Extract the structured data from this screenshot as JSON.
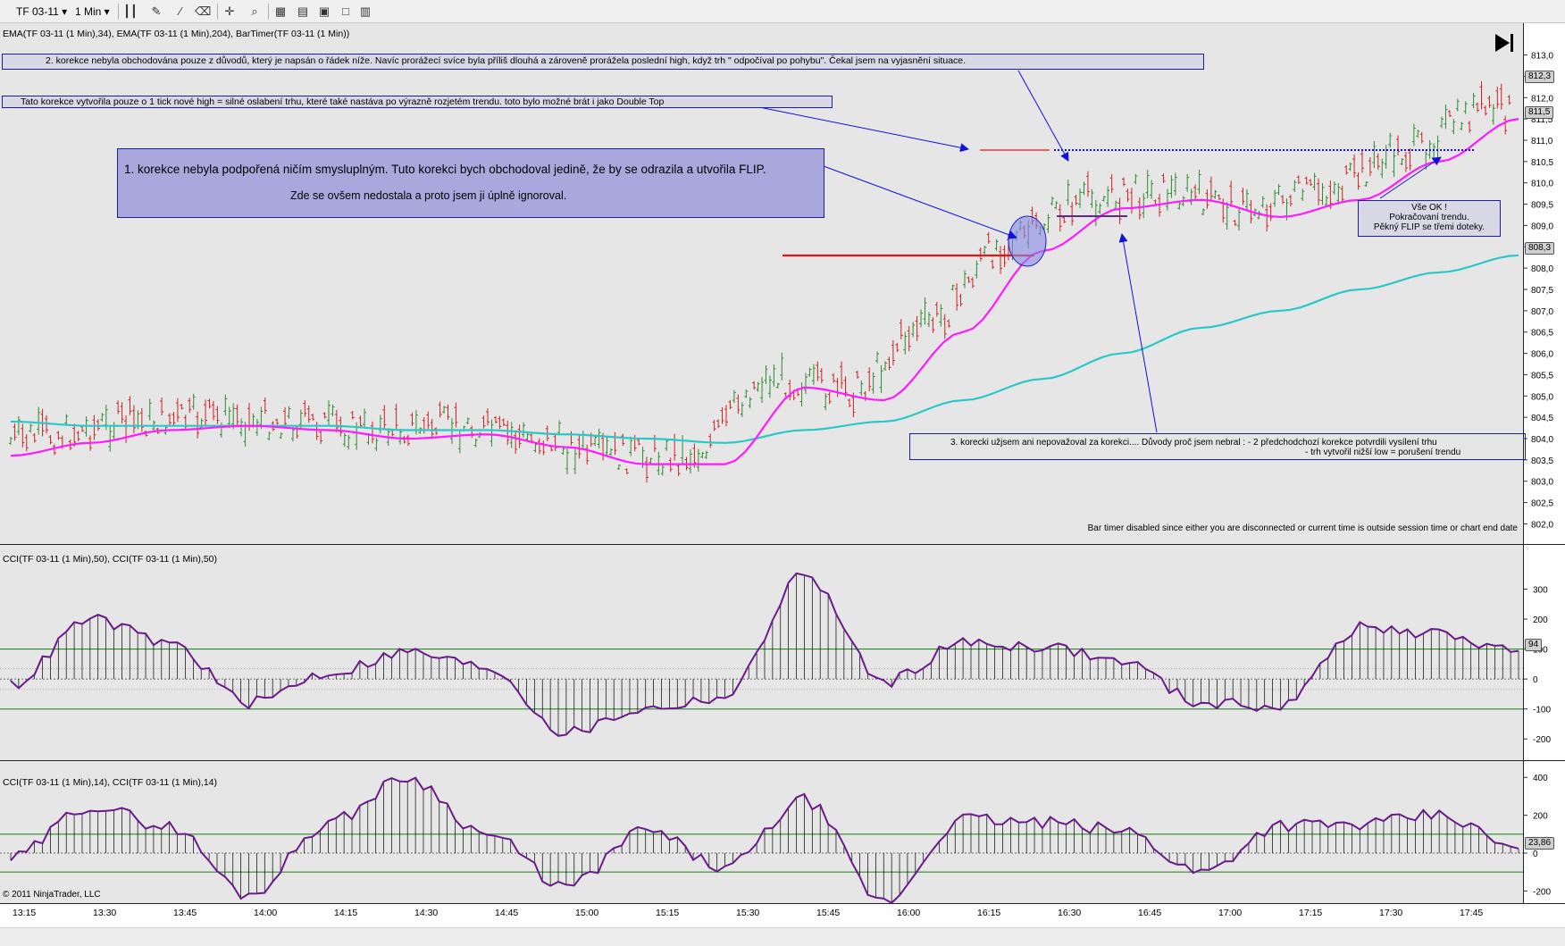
{
  "toolbar": {
    "instrument": "TF 03-11",
    "period": "1 Min"
  },
  "price_panel": {
    "indicator_label": "EMA(TF 03-11 (1 Min),34), EMA(TF 03-11 (1 Min),204), BarTimer(TF 03-11 (1 Min))",
    "y_ticks": [
      "813,0",
      "812,5",
      "812,0",
      "811,5",
      "811,0",
      "810,5",
      "810,0",
      "809,5",
      "809,0",
      "808,5",
      "808,0",
      "807,5",
      "807,0",
      "806,5",
      "806,0",
      "805,5",
      "805,0",
      "804,5",
      "804,0",
      "803,5",
      "803,0",
      "802,5",
      "802,0"
    ],
    "badges": {
      "last": "812,3",
      "ema34": "811,5",
      "ema204": "808,3"
    },
    "bar_timer_text": "Bar timer disabled since either you are disconnected or current time is outside session time or chart end date"
  },
  "annotations": {
    "a1": "2. korekce nebyla obchodována pouze z důvodů, který je napsán o řádek níže. Navíc prorážecí svíce byla příliš dlouhá a zároveně prorážela poslední high, když trh \" odpočíval po pohybu\". Čekal jsem na vyjasnění situace.",
    "a2": "Tato korekce vytvořila pouze o 1 tick nové high = silné oslabení trhu, které také nastáva po výrazně rozjetém trendu. toto bylo možné brát i jako Double Top",
    "a3_line1": "1. korekce nebyla podpořená ničím smysluplným. Tuto korekci bych obchodoval jedině, že by se odrazila a utvořila FLIP.",
    "a3_line2": "Zde se ovšem nedostala a proto jsem ji úplně ignoroval.",
    "a4_line1": "3. korecki užjsem ani nepovažoval za korekci.... Důvody proč jsem nebral : - 2 předchodchozí korekce potvrdili vysílení trhu",
    "a4_line2": "- trh vytvořil nižší low = porušení trendu",
    "a5_line1": "Vše OK !",
    "a5_line2": "Pokračovaní trendu.",
    "a5_line3": "Pěkný FLIP se třemi doteky."
  },
  "cci50_panel": {
    "label": "CCI(TF 03-11 (1 Min),50), CCI(TF 03-11 (1 Min),50)",
    "y_ticks": [
      "300",
      "200",
      "100",
      "0",
      "-100",
      "-200"
    ],
    "badge": "94"
  },
  "cci14_panel": {
    "label": "CCI(TF 03-11 (1 Min),14), CCI(TF 03-11 (1 Min),14)",
    "y_ticks": [
      "400",
      "200",
      "0",
      "-200"
    ],
    "badge": "23,86"
  },
  "time_axis": [
    "13:15",
    "13:30",
    "13:45",
    "14:00",
    "14:15",
    "14:30",
    "14:45",
    "15:00",
    "15:15",
    "15:30",
    "15:45",
    "16:00",
    "16:15",
    "16:30",
    "16:45",
    "17:00",
    "17:15",
    "17:30",
    "17:45"
  ],
  "copyright": "© 2011 NinjaTrader, LLC",
  "colors": {
    "background": "#e6e6e6",
    "up_bar": "#2e8b2e",
    "down_bar": "#d02020",
    "ema34": "#ff1aff",
    "ema204": "#2cc8c8",
    "cci": "#6a1b8a",
    "arrow": "#1010e0",
    "annotation_border": "#1e1e9a"
  },
  "chart_data": [
    {
      "type": "line",
      "title": "",
      "series": [
        {
          "name": "EMA(TF 03-11 (1 Min),34)",
          "x": [
            "13:15",
            "13:30",
            "13:45",
            "14:00",
            "14:15",
            "14:30",
            "14:45",
            "15:00",
            "15:15",
            "15:30",
            "15:45",
            "16:00",
            "16:15",
            "16:30",
            "16:45",
            "17:00",
            "17:15",
            "17:30",
            "17:45",
            "17:55"
          ],
          "values": [
            803.6,
            803.9,
            804.2,
            804.3,
            804.2,
            804.0,
            804.1,
            803.8,
            803.4,
            803.4,
            805.2,
            804.9,
            806.5,
            808.4,
            809.4,
            809.6,
            809.2,
            809.6,
            810.5,
            811.5
          ]
        },
        {
          "name": "EMA(TF 03-11 (1 Min),204)",
          "x": [
            "13:15",
            "13:30",
            "13:45",
            "14:00",
            "14:15",
            "14:30",
            "14:45",
            "15:00",
            "15:15",
            "15:30",
            "15:45",
            "16:00",
            "16:15",
            "16:30",
            "16:45",
            "17:00",
            "17:15",
            "17:30",
            "17:45",
            "17:55"
          ],
          "values": [
            804.4,
            804.3,
            804.3,
            804.3,
            804.3,
            804.2,
            804.2,
            804.1,
            804.0,
            803.9,
            804.2,
            804.4,
            804.9,
            805.4,
            806.0,
            806.6,
            807.0,
            807.5,
            807.9,
            808.3
          ]
        }
      ],
      "ylim": [
        801.8,
        813.2
      ]
    },
    {
      "type": "bar",
      "title": "",
      "x": [
        "13:15",
        "13:30",
        "13:45",
        "14:00",
        "14:15",
        "14:30",
        "14:45",
        "15:00",
        "15:15",
        "15:30",
        "15:45",
        "16:00",
        "16:15",
        "16:30",
        "16:45",
        "17:00",
        "17:15",
        "17:30",
        "17:45",
        "17:55"
      ],
      "values": [
        -20,
        200,
        120,
        -80,
        20,
        90,
        40,
        -180,
        -100,
        -60,
        350,
        -10,
        120,
        110,
        60,
        -80,
        -90,
        170,
        150,
        94
      ],
      "ylim": [
        -250,
        370
      ]
    },
    {
      "type": "bar",
      "title": "",
      "x": [
        "13:15",
        "13:30",
        "13:45",
        "14:00",
        "14:15",
        "14:30",
        "14:45",
        "15:00",
        "15:15",
        "15:30",
        "15:45",
        "16:00",
        "16:15",
        "16:30",
        "16:45",
        "17:00",
        "17:15",
        "17:30",
        "17:45",
        "17:55"
      ],
      "values": [
        -30,
        250,
        140,
        -220,
        160,
        400,
        100,
        -180,
        120,
        -80,
        280,
        -260,
        180,
        160,
        120,
        -100,
        150,
        150,
        200,
        23.86
      ],
      "ylim": [
        -250,
        420
      ]
    }
  ]
}
